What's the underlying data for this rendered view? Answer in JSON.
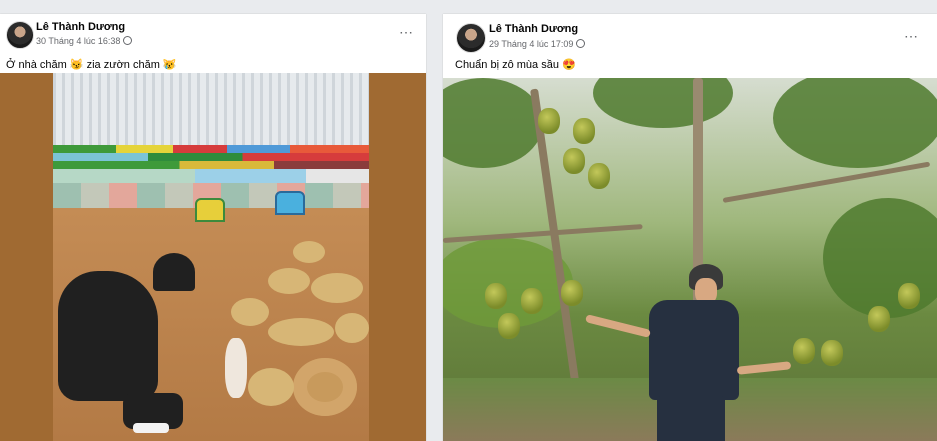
{
  "posts": [
    {
      "author": "Lê Thành Dương",
      "timestamp": "30 Tháng 4 lúc 16:38",
      "caption": "Ở nhà chăm 😼 zia zườn chăm 😿",
      "more_icon": "⋯",
      "photo_icon": "photo-rabbit-farm"
    },
    {
      "author": "Lê Thành Dương",
      "timestamp": "29 Tháng 4 lúc 17:09",
      "caption": "Chuẩn bị zô mùa sầu 😍",
      "more_icon": "⋯",
      "photo_icon": "photo-durian-orchard"
    }
  ]
}
